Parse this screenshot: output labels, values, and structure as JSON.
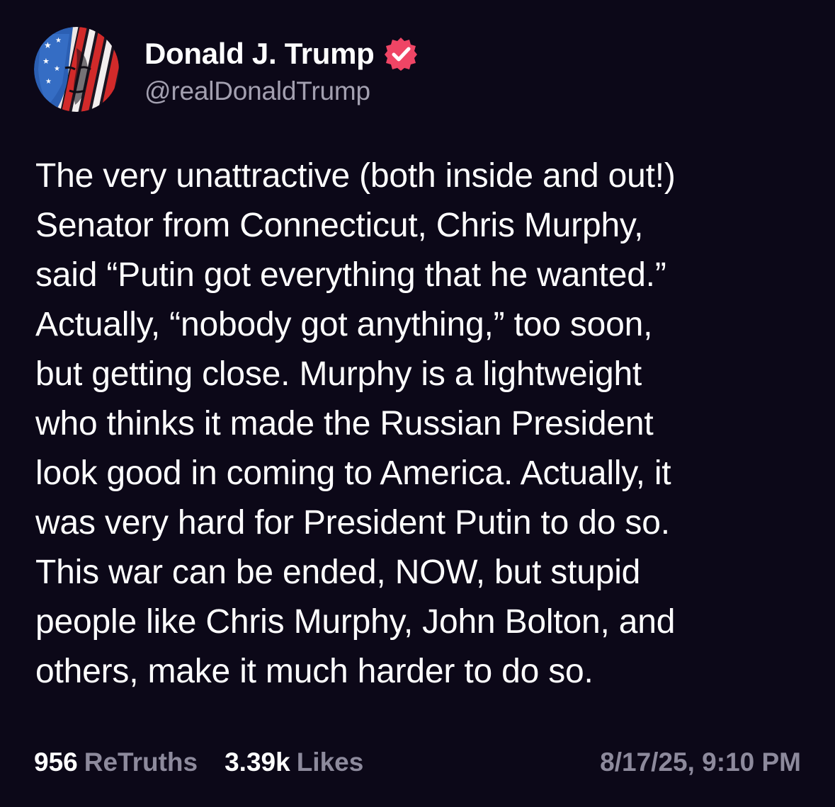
{
  "author": {
    "display_name": "Donald J. Trump",
    "handle": "@realDonaldTrump",
    "verified": true,
    "verified_color": "#ef4565"
  },
  "post": {
    "text": "The very unattractive (both inside and out!)\nSenator from Connecticut, Chris Murphy,\nsaid “Putin got everything that he wanted.”\nActually, “nobody got anything,” too soon,\nbut getting close. Murphy is a lightweight\nwho thinks it made the Russian President\nlook good in coming to America. Actually, it\nwas very hard for President Putin to do so.\nThis war can be ended, NOW, but stupid\npeople like Chris Murphy, John Bolton, and\nothers, make it much harder to do so."
  },
  "stats": {
    "retruths_count": "956",
    "retruths_label": "ReTruths",
    "likes_count": "3.39k",
    "likes_label": "Likes"
  },
  "timestamp": "8/17/25, 9:10 PM",
  "icons": {
    "avatar": "profile-avatar",
    "verified": "verified-badge-icon"
  },
  "colors": {
    "background": "#0c0818",
    "text": "#ffffff",
    "secondary": "#8d8a9c",
    "handle": "#a3a0b0"
  }
}
